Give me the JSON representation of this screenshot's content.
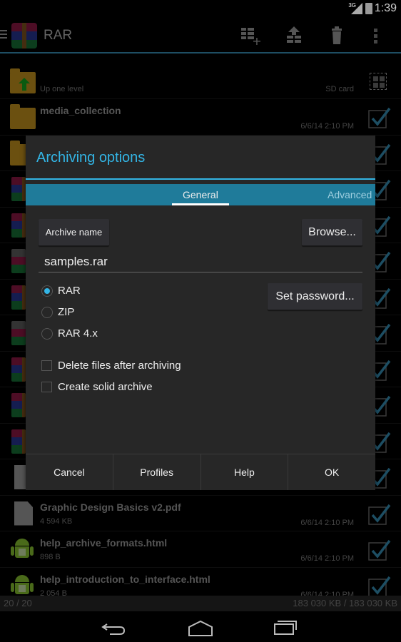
{
  "status_bar": {
    "network": "3G",
    "time": "1:39"
  },
  "action_bar": {
    "title": "RAR",
    "icons": [
      "add-to-archive-icon",
      "extract-icon",
      "delete-icon",
      "overflow-menu-icon"
    ]
  },
  "file_list": {
    "up_row": {
      "label": "Up one level",
      "location": "SD card"
    },
    "items": [
      {
        "type": "folder",
        "name": "media_collection",
        "size": "",
        "date": "6/6/14 2:10 PM",
        "checked": true
      },
      {
        "type": "folder",
        "name": "",
        "size": "",
        "date": "",
        "checked": true
      },
      {
        "type": "rar",
        "name": "",
        "size": "",
        "date": "",
        "checked": true
      },
      {
        "type": "rar",
        "name": "",
        "size": "",
        "date": "",
        "checked": true
      },
      {
        "type": "rar-split",
        "name": "",
        "size": "",
        "date": "",
        "checked": true
      },
      {
        "type": "rar",
        "name": "",
        "size": "",
        "date": "",
        "checked": true
      },
      {
        "type": "rar-split",
        "name": "",
        "size": "",
        "date": "",
        "checked": true
      },
      {
        "type": "rar",
        "name": "",
        "size": "",
        "date": "",
        "checked": true
      },
      {
        "type": "rar",
        "name": "",
        "size": "",
        "date": "",
        "checked": true
      },
      {
        "type": "rar",
        "name": "",
        "size": "",
        "date": "",
        "checked": true
      },
      {
        "type": "doc",
        "name": "",
        "size": "",
        "date": "",
        "checked": true
      },
      {
        "type": "doc",
        "name": "Graphic Design Basics v2.pdf",
        "size": "4 594 KB",
        "date": "6/6/14 2:10 PM",
        "checked": true
      },
      {
        "type": "android",
        "name": "help_archive_formats.html",
        "size": "898 B",
        "date": "6/6/14 2:10 PM",
        "checked": true
      },
      {
        "type": "android",
        "name": "help_introduction_to_interface.html",
        "size": "2 054 B",
        "date": "6/6/14 2:10 PM",
        "checked": true
      }
    ]
  },
  "summary": {
    "count": "20 / 20",
    "size": "183 030 KB / 183 030 KB"
  },
  "dialog": {
    "title": "Archiving options",
    "tabs": [
      {
        "label": "General",
        "active": true
      },
      {
        "label": "Advanced",
        "active": false
      }
    ],
    "archive_name_button": "Archive name",
    "browse_button": "Browse...",
    "archive_name_value": "samples.rar",
    "archive_name_placeholder": "",
    "formats": [
      {
        "label": "RAR",
        "selected": true
      },
      {
        "label": "ZIP",
        "selected": false
      },
      {
        "label": "RAR 4.x",
        "selected": false
      }
    ],
    "set_password_button": "Set password...",
    "options": [
      {
        "label": "Delete files after archiving",
        "checked": false
      },
      {
        "label": "Create solid archive",
        "checked": false
      }
    ],
    "footer_buttons": [
      "Cancel",
      "Profiles",
      "Help",
      "OK"
    ]
  },
  "colors": {
    "accent": "#33b5e5",
    "tab_bar": "#1f7b9a",
    "dialog_bg": "#272727"
  }
}
